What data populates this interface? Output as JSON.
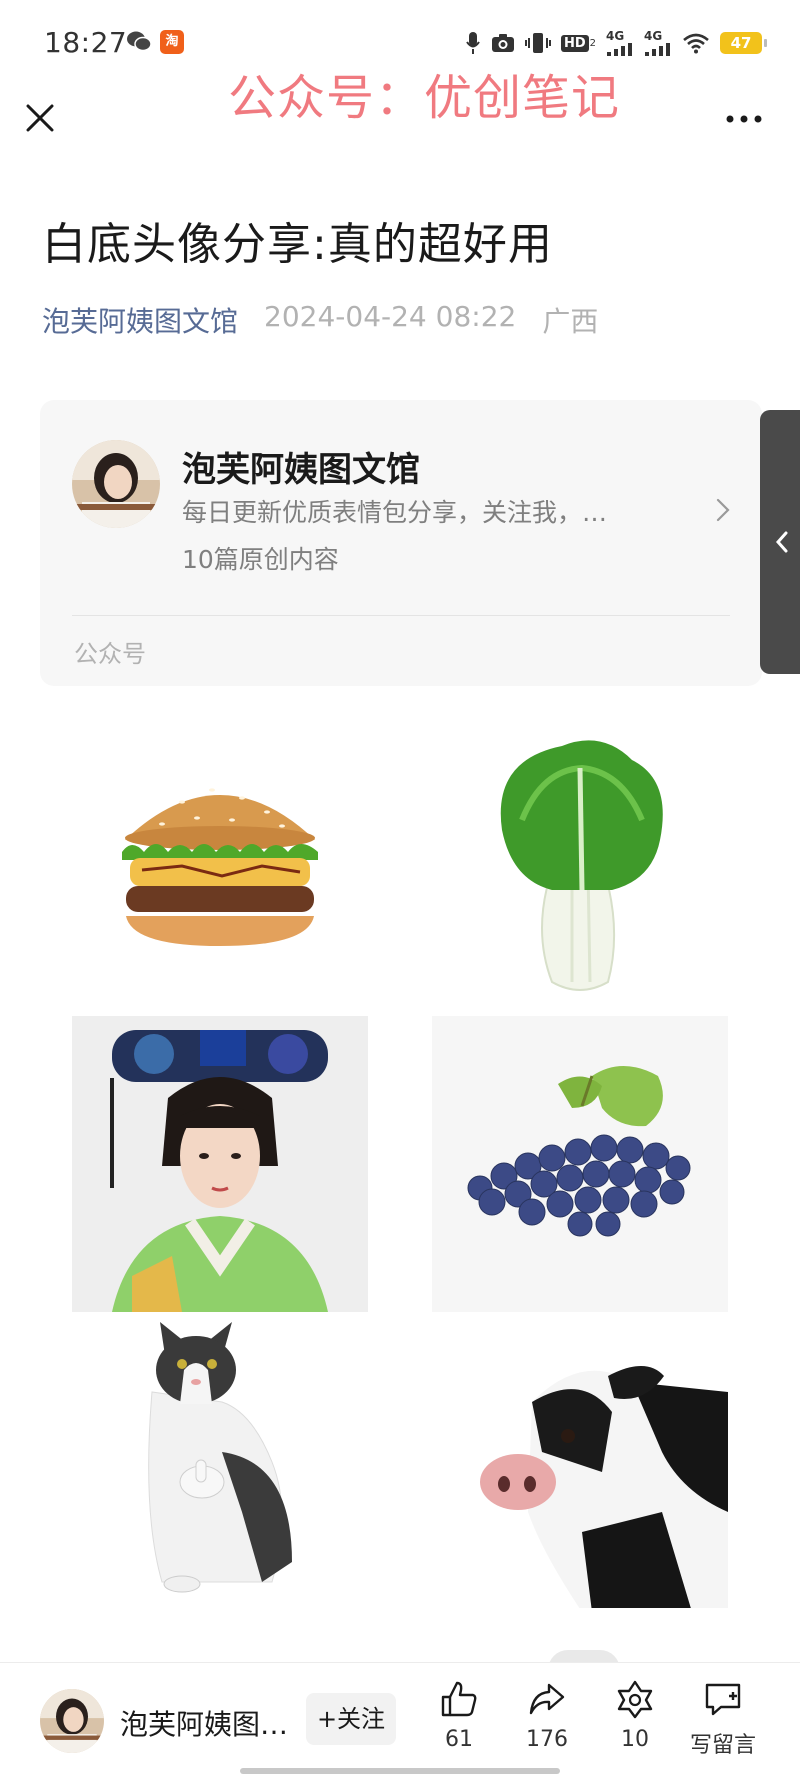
{
  "status_bar": {
    "time": "18:27",
    "app_badge": "淘",
    "network_1": "4G",
    "network_2": "4G",
    "hd_label": "HD",
    "battery": "47"
  },
  "watermark": "公众号：优创笔记",
  "article": {
    "title": "白底头像分享:真的超好用",
    "author": "泡芙阿姨图文馆",
    "date": "2024-04-24 08:22",
    "location": "广西"
  },
  "account_card": {
    "name": "泡芙阿姨图文馆",
    "description": "每日更新优质表情包分享，关注我，…",
    "original_count": "10篇原创内容",
    "type_label": "公众号"
  },
  "images": [
    {
      "subject": "hamburger"
    },
    {
      "subject": "bok-choy"
    },
    {
      "subject": "qing-dynasty-woman"
    },
    {
      "subject": "grapes"
    },
    {
      "subject": "cat-thumbs-up"
    },
    {
      "subject": "calf"
    }
  ],
  "bottom_bar": {
    "account_name": "泡芙阿姨图…",
    "follow_label": "+关注",
    "like_count": "61",
    "share_count": "176",
    "recommend_count": "10",
    "comment_label": "写留言"
  },
  "colors": {
    "author_link": "#576b95",
    "meta_gray": "#b2b2b2",
    "watermark": "#f07a80",
    "card_bg": "#f7f7f7",
    "battery": "#f2c21b"
  }
}
